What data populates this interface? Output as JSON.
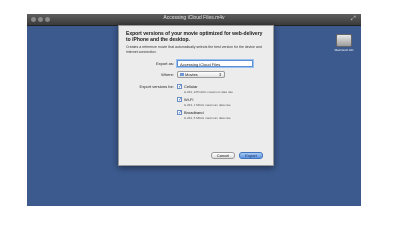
{
  "window": {
    "title": "Accessing iCloud Files.m4v"
  },
  "desktop": {
    "drive_label": "Macintosh HD"
  },
  "export_sheet": {
    "heading": "Export versions of your movie optimized for web-delivery to iPhone and the desktop.",
    "description": "Creates a reference movie that automatically selects the best version for the device and internet connection.",
    "export_as_label": "Export as:",
    "export_as_value": "Accessing iCloud Files",
    "where_label": "Where:",
    "where_value": "Movies",
    "versions_label": "Export versions for:",
    "options": [
      {
        "label": "Cellular",
        "detail": "H.264, 225 kbit/s maximum data rate",
        "checked": true
      },
      {
        "label": "Wi-Fi",
        "detail": "H.264, 1 Mbit/s maximum data rate",
        "checked": true
      },
      {
        "label": "Broadband",
        "detail": "H.264, 5 Mbit/s maximum data rate",
        "checked": true
      }
    ],
    "cancel_label": "Cancel",
    "export_label": "Export"
  }
}
